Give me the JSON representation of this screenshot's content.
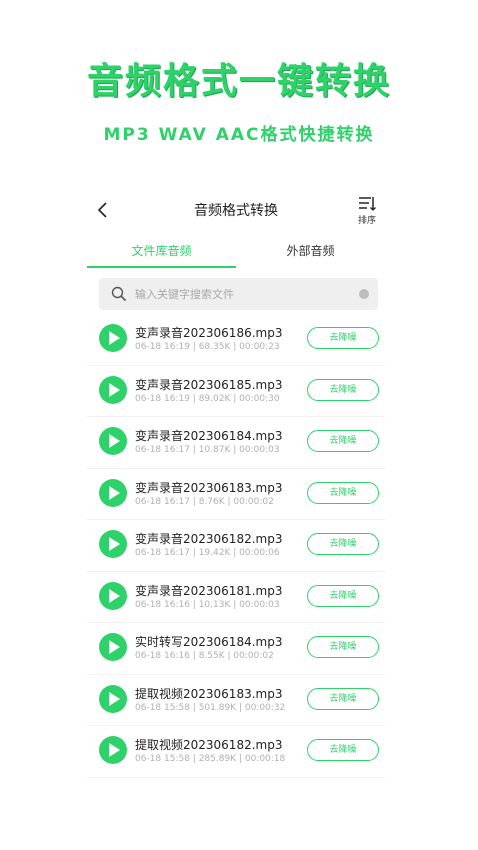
{
  "promo": {
    "title": "音频格式一键转换",
    "subtitle": "MP3 WAV AAC格式快捷转换"
  },
  "nav": {
    "title": "音频格式转换",
    "sort_label": "排序"
  },
  "tabs": [
    {
      "label": "文件库音频",
      "active": true
    },
    {
      "label": "外部音频",
      "active": false
    }
  ],
  "search": {
    "placeholder": "输入关键字搜索文件"
  },
  "files": [
    {
      "name": "变声录音202306186.mp3",
      "meta": "06-18 16:19 | 68.35K | 00:00:23",
      "action": "去降噪"
    },
    {
      "name": "变声录音202306185.mp3",
      "meta": "06-18 16:19 | 89.02K | 00:00:30",
      "action": "去降噪"
    },
    {
      "name": "变声录音202306184.mp3",
      "meta": "06-18 16:17 | 10.87K | 00:00:03",
      "action": "去降噪"
    },
    {
      "name": "变声录音202306183.mp3",
      "meta": "06-18 16:17 | 8.76K | 00:00:02",
      "action": "去降噪"
    },
    {
      "name": "变声录音202306182.mp3",
      "meta": "06-18 16:17 | 19.42K | 00:00:06",
      "action": "去降噪"
    },
    {
      "name": "变声录音202306181.mp3",
      "meta": "06-18 16:16 | 10.13K | 00:00:03",
      "action": "去降噪"
    },
    {
      "name": "实时转写202306184.mp3",
      "meta": "06-18 16:16 | 8.55K | 00:00:02",
      "action": "去降噪"
    },
    {
      "name": "提取视频202306183.mp3",
      "meta": "06-18 15:58 | 501.89K | 00:00:32",
      "action": "去降噪"
    },
    {
      "name": "提取视频202306182.mp3",
      "meta": "06-18 15:58 | 285.89K | 00:00:18",
      "action": "去降噪"
    }
  ],
  "colors": {
    "accent": "#2fd16a"
  }
}
